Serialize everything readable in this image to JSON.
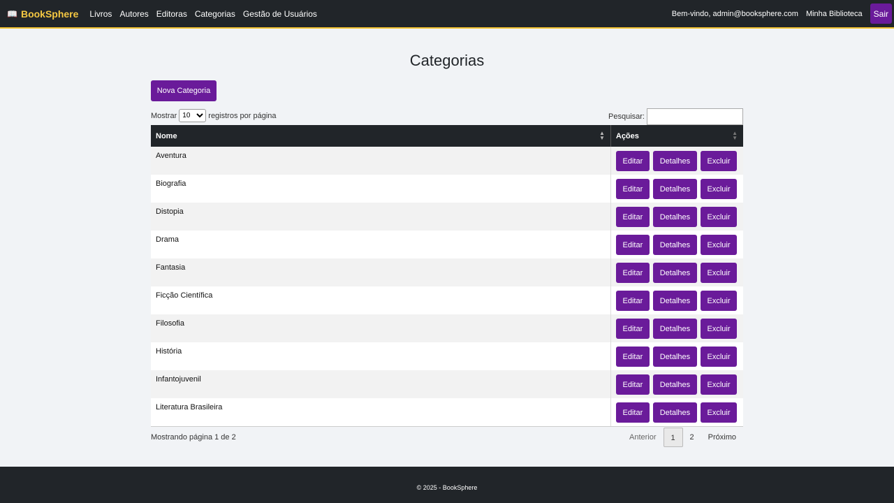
{
  "navbar": {
    "brand": "BookSphere",
    "brand_icon": "open-book-icon",
    "links": [
      "Livros",
      "Autores",
      "Editoras",
      "Categorias",
      "Gestão de Usuários"
    ],
    "welcome": "Bem-vindo, admin@booksphere.com",
    "my_library": "Minha Biblioteca",
    "logout": "Sair"
  },
  "page": {
    "title": "Categorias",
    "new_button": "Nova Categoria"
  },
  "table_controls": {
    "show_label": "Mostrar",
    "page_size": "10",
    "per_page_label": "registros por página",
    "search_label": "Pesquisar:",
    "search_value": ""
  },
  "table": {
    "headers": [
      "Nome",
      "Ações"
    ],
    "rows": [
      "Aventura",
      "Biografia",
      "Distopia",
      "Drama",
      "Fantasia",
      "Ficção Científica",
      "Filosofia",
      "História",
      "Infantojuvenil",
      "Literatura Brasileira"
    ],
    "actions": {
      "edit": "Editar",
      "details": "Detalhes",
      "delete": "Excluir"
    }
  },
  "pagination": {
    "info": "Mostrando página 1 de 2",
    "previous": "Anterior",
    "pages": [
      "1",
      "2"
    ],
    "next": "Próximo"
  },
  "footer": {
    "text": "© 2025 - BookSphere"
  },
  "colors": {
    "accent": "#6a1b9a",
    "brand": "#f5c842",
    "navbar": "#212529"
  }
}
